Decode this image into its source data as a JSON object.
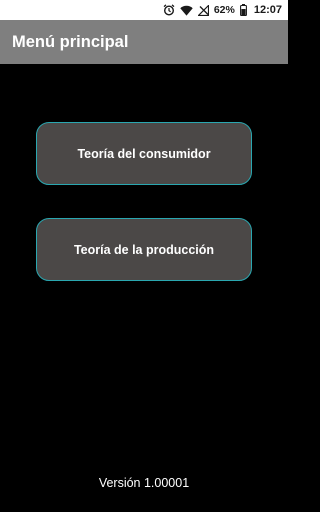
{
  "status_bar": {
    "icons": [
      "alarm-icon",
      "wifi-icon",
      "signal-off-icon",
      "battery-icon"
    ],
    "battery_percent": "62%",
    "time": "12:07"
  },
  "app_bar": {
    "title": "Menú principal",
    "background": "#7f7f7f"
  },
  "menu": {
    "items": [
      {
        "label": "Teoría del consumidor"
      },
      {
        "label": "Teoría de la producción"
      }
    ],
    "button_fill": "#4b4847",
    "button_border": "#2aa7b0"
  },
  "footer": {
    "version": "Versión 1.00001"
  }
}
